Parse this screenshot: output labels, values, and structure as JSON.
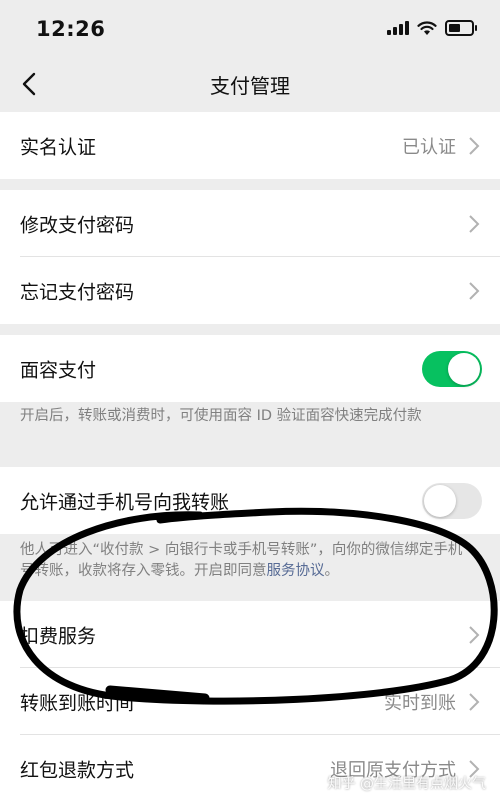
{
  "status_bar": {
    "time": "12:26"
  },
  "nav": {
    "title": "支付管理"
  },
  "rows": {
    "real_name": {
      "label": "实名认证",
      "value": "已认证"
    },
    "change_pwd": {
      "label": "修改支付密码"
    },
    "forgot_pwd": {
      "label": "忘记支付密码"
    },
    "face_pay": {
      "label": "面容支付",
      "enabled": true,
      "description": "开启后，转账或消费时，可使用面容 ID 验证面容快速完成付款"
    },
    "phone_transfer": {
      "label": "允许通过手机号向我转账",
      "enabled": false,
      "description": "他人可进入“收付款 > 向银行卡或手机号转账”，向你的微信绑定手机号转账，收款将存入零钱。开启即同意",
      "link": "服务协议",
      "suffix": "。"
    },
    "deduction": {
      "label": "扣费服务"
    },
    "arrival_time": {
      "label": "转账到账时间",
      "value": "实时到账"
    },
    "refund": {
      "label": "红包退款方式",
      "value": "退回原支付方式"
    }
  },
  "watermark": "知乎 @生活里有点烟火气",
  "colors": {
    "toggle_on": "#07c160",
    "link": "#576b95",
    "background": "#ededed"
  }
}
